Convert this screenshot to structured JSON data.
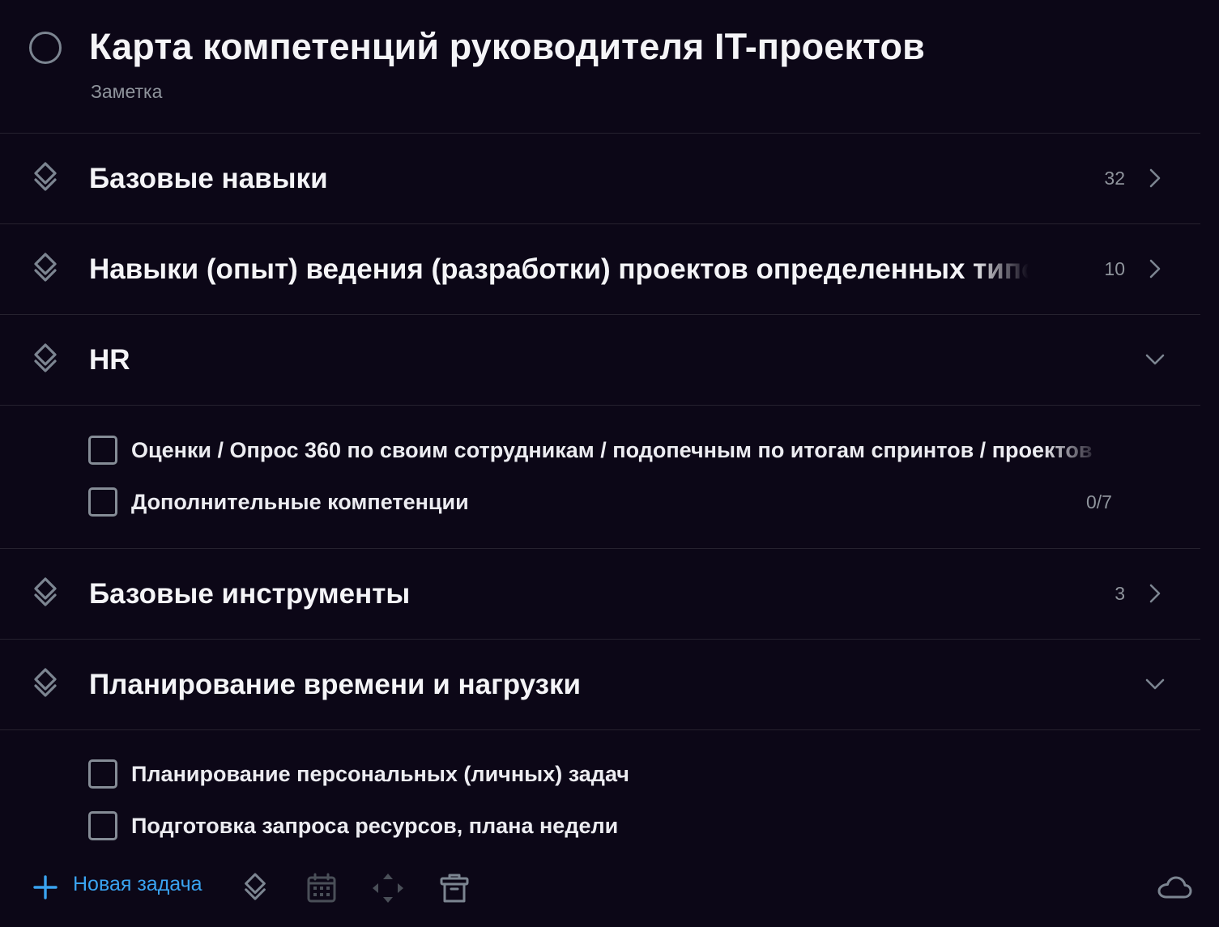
{
  "header": {
    "title": "Карта компетенций руководителя IT-проектов",
    "subtitle": "Заметка"
  },
  "headings": [
    {
      "title": "Базовые навыки",
      "count": "32",
      "expanded": false
    },
    {
      "title": "Навыки (опыт) ведения (разработки) проектов определенных типов",
      "count": "10",
      "expanded": false
    },
    {
      "title": "HR",
      "count": "",
      "expanded": true
    },
    {
      "title": "Базовые инструменты",
      "count": "3",
      "expanded": false
    },
    {
      "title": "Планирование времени и нагрузки",
      "count": "",
      "expanded": true
    }
  ],
  "hr_tasks": [
    {
      "title": "Оценки / Опрос 360 по своим сотрудникам / подопечным по итогам спринтов / проектов",
      "progress": ""
    },
    {
      "title": "Дополнительные компетенции",
      "progress": "0/7"
    }
  ],
  "planning_tasks": [
    {
      "title": "Планирование персональных (личных) задач",
      "progress": ""
    },
    {
      "title": "Подготовка запроса ресурсов, плана недели",
      "progress": ""
    }
  ],
  "footer": {
    "new_task_label": "Новая задача",
    "icons": [
      "plus-icon",
      "heading-icon",
      "calendar-icon",
      "move-icon",
      "trash-icon",
      "cloud-icon"
    ]
  },
  "colors": {
    "background": "#0c0717",
    "accent": "#3aa3f0",
    "muted": "#8f949c",
    "divider": "#26222f"
  }
}
